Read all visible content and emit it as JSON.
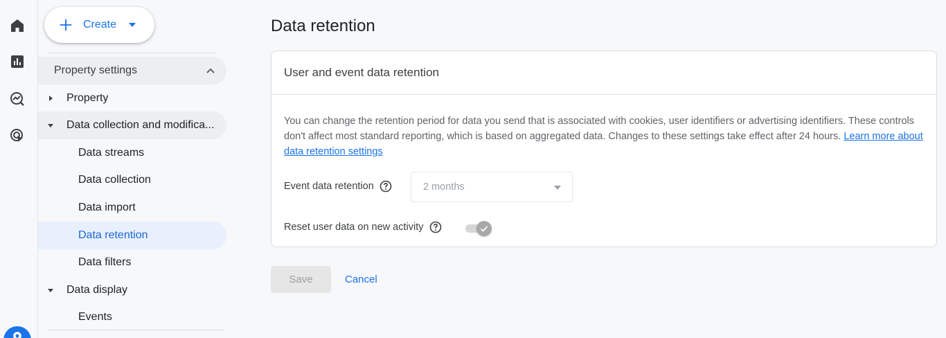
{
  "rail": {
    "icons": [
      "home-icon",
      "reports-icon",
      "explore-icon",
      "advertising-icon",
      "admin-gear-icon"
    ]
  },
  "nav": {
    "create_label": "Create",
    "section_header": "Property settings",
    "items": [
      {
        "label": "Property",
        "type": "group",
        "expanded": false
      },
      {
        "label": "Data collection and modifica...",
        "type": "group",
        "expanded": true
      },
      {
        "label": "Data streams",
        "type": "sub"
      },
      {
        "label": "Data collection",
        "type": "sub"
      },
      {
        "label": "Data import",
        "type": "sub"
      },
      {
        "label": "Data retention",
        "type": "sub",
        "selected": true
      },
      {
        "label": "Data filters",
        "type": "sub"
      },
      {
        "label": "Data display",
        "type": "group",
        "expanded": true
      },
      {
        "label": "Events",
        "type": "sub"
      }
    ]
  },
  "main": {
    "page_title": "Data retention",
    "card": {
      "title": "User and event data retention",
      "description": "You can change the retention period for data you send that is associated with cookies, user identifiers or advertising identifiers. These controls don't affect most standard reporting, which is based on aggregated data. Changes to these settings take effect after 24 hours.",
      "learn_more_link": "Learn more about data retention settings",
      "event_retention_label": "Event data retention",
      "event_retention_value": "2 months",
      "reset_label": "Reset user data on new activity",
      "reset_enabled": true
    },
    "save_label": "Save",
    "cancel_label": "Cancel"
  },
  "colors": {
    "accent": "#1a73e8",
    "selected_bg": "#e8f0fe",
    "disabled": "#9aa0a6"
  }
}
